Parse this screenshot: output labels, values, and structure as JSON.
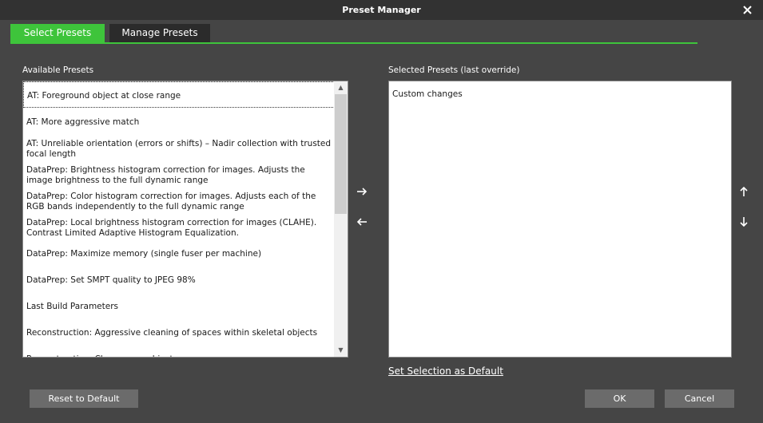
{
  "window": {
    "title": "Preset Manager"
  },
  "tabs": [
    {
      "label": "Select Presets",
      "active": true
    },
    {
      "label": "Manage Presets",
      "active": false
    }
  ],
  "available": {
    "label": "Available Presets",
    "items": [
      "AT: Foreground object at close range",
      "AT: More aggressive match",
      "AT: Unreliable orientation (errors or shifts) – Nadir collection with trusted focal length",
      "DataPrep: Brightness histogram correction for images. Adjusts the image brightness to the full dynamic range",
      "DataPrep: Color histogram correction for images. Adjusts each of the RGB bands independently to the full dynamic range",
      "DataPrep: Local brightness histogram correction for images (CLAHE). Contrast Limited Adaptive Histogram Equalization.",
      "DataPrep: Maximize memory (single fuser per machine)",
      "DataPrep: Set SMPT quality to JPEG 98%",
      "Last Build Parameters",
      "Reconstruction: Aggressive cleaning of spaces within skeletal objects",
      "Reconstruction: Close range object"
    ]
  },
  "selected": {
    "label": "Selected Presets (last override)",
    "items": [
      "Custom changes"
    ]
  },
  "links": {
    "set_default": "Set Selection as Default"
  },
  "buttons": {
    "reset": "Reset to Default",
    "ok": "OK",
    "cancel": "Cancel"
  },
  "colors": {
    "accent": "#3ec43b",
    "background": "#454545",
    "titlebar": "#323232",
    "button": "#6b6b6b"
  },
  "icons": [
    "close-icon",
    "arrow-right-icon",
    "arrow-left-icon",
    "arrow-up-icon",
    "arrow-down-icon"
  ]
}
